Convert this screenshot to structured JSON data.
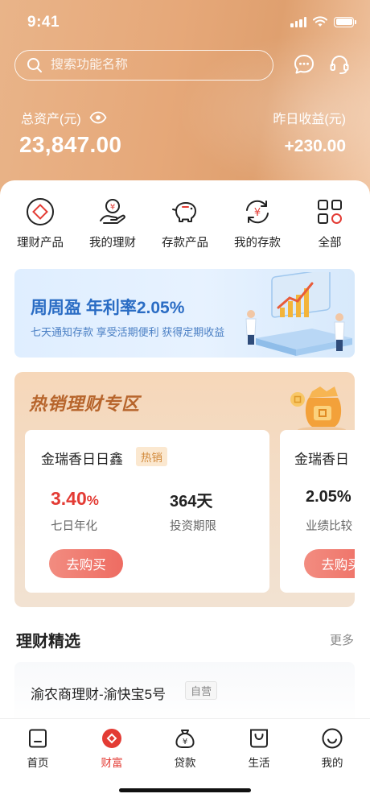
{
  "status_bar": {
    "time": "9:41"
  },
  "search": {
    "placeholder": "搜索功能名称"
  },
  "header_icons": [
    "message-icon",
    "customer-service-icon"
  ],
  "assets": {
    "total_label": "总资产(元)",
    "total_value": "23,847.00",
    "yesterday_label": "昨日收益(元)",
    "yesterday_value": "+230.00"
  },
  "quick_actions": [
    {
      "label": "理财产品",
      "icon": "diamond-icon"
    },
    {
      "label": "我的理财",
      "icon": "hand-yuan-icon"
    },
    {
      "label": "存款产品",
      "icon": "piggy-bank-icon"
    },
    {
      "label": "我的存款",
      "icon": "yuan-refresh-icon"
    },
    {
      "label": "全部",
      "icon": "grid-icon"
    }
  ],
  "banner": {
    "title": "周周盈 年利率2.05%",
    "subtitle": "七天通知存款 享受活期便利 获得定期收益"
  },
  "hot_zone": {
    "title": "热销理财专区",
    "products": [
      {
        "name": "金瑞香日日鑫",
        "tag": "热销",
        "rate": "3.40",
        "rate_unit": "%",
        "rate_label": "七日年化",
        "term": "364天",
        "term_label": "投资期限",
        "button": "去购买"
      },
      {
        "name": "金瑞香日",
        "rate": "2.05%",
        "rate_label": "业绩比较",
        "button": "去购买"
      }
    ]
  },
  "featured": {
    "title": "理财精选",
    "more": "更多",
    "items": [
      {
        "name": "渝农商理财-渝快宝5号",
        "tag": "自营"
      }
    ]
  },
  "tabbar": [
    {
      "label": "首页",
      "icon": "home-icon",
      "active": false
    },
    {
      "label": "财富",
      "icon": "wealth-icon",
      "active": true
    },
    {
      "label": "贷款",
      "icon": "loan-bag-icon",
      "active": false
    },
    {
      "label": "生活",
      "icon": "shopping-bag-icon",
      "active": false
    },
    {
      "label": "我的",
      "icon": "smile-face-icon",
      "active": false
    }
  ],
  "colors": {
    "accent": "#e33b34",
    "header": "#e6a879",
    "banner_text": "#2a6cc4",
    "hot_title": "#b7652c"
  }
}
